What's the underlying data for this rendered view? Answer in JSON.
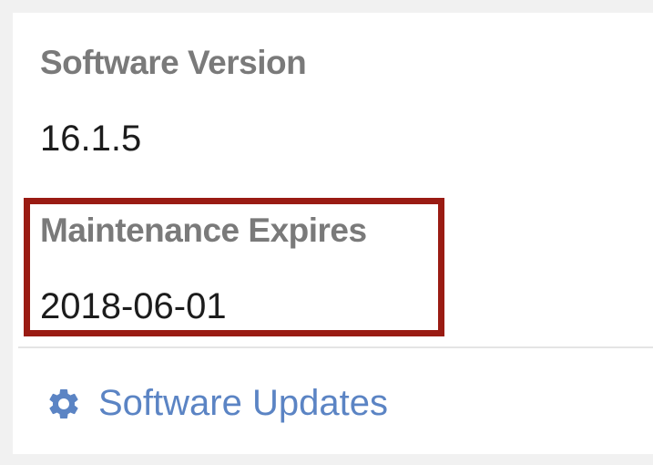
{
  "software_version": {
    "label": "Software Version",
    "value": "16.1.5"
  },
  "maintenance": {
    "label": "Maintenance Expires",
    "value": "2018-06-01",
    "highlight_color": "#9a1b13"
  },
  "updates_link": {
    "label": "Software Updates",
    "icon": "gear-icon",
    "color": "#5b84c4"
  }
}
